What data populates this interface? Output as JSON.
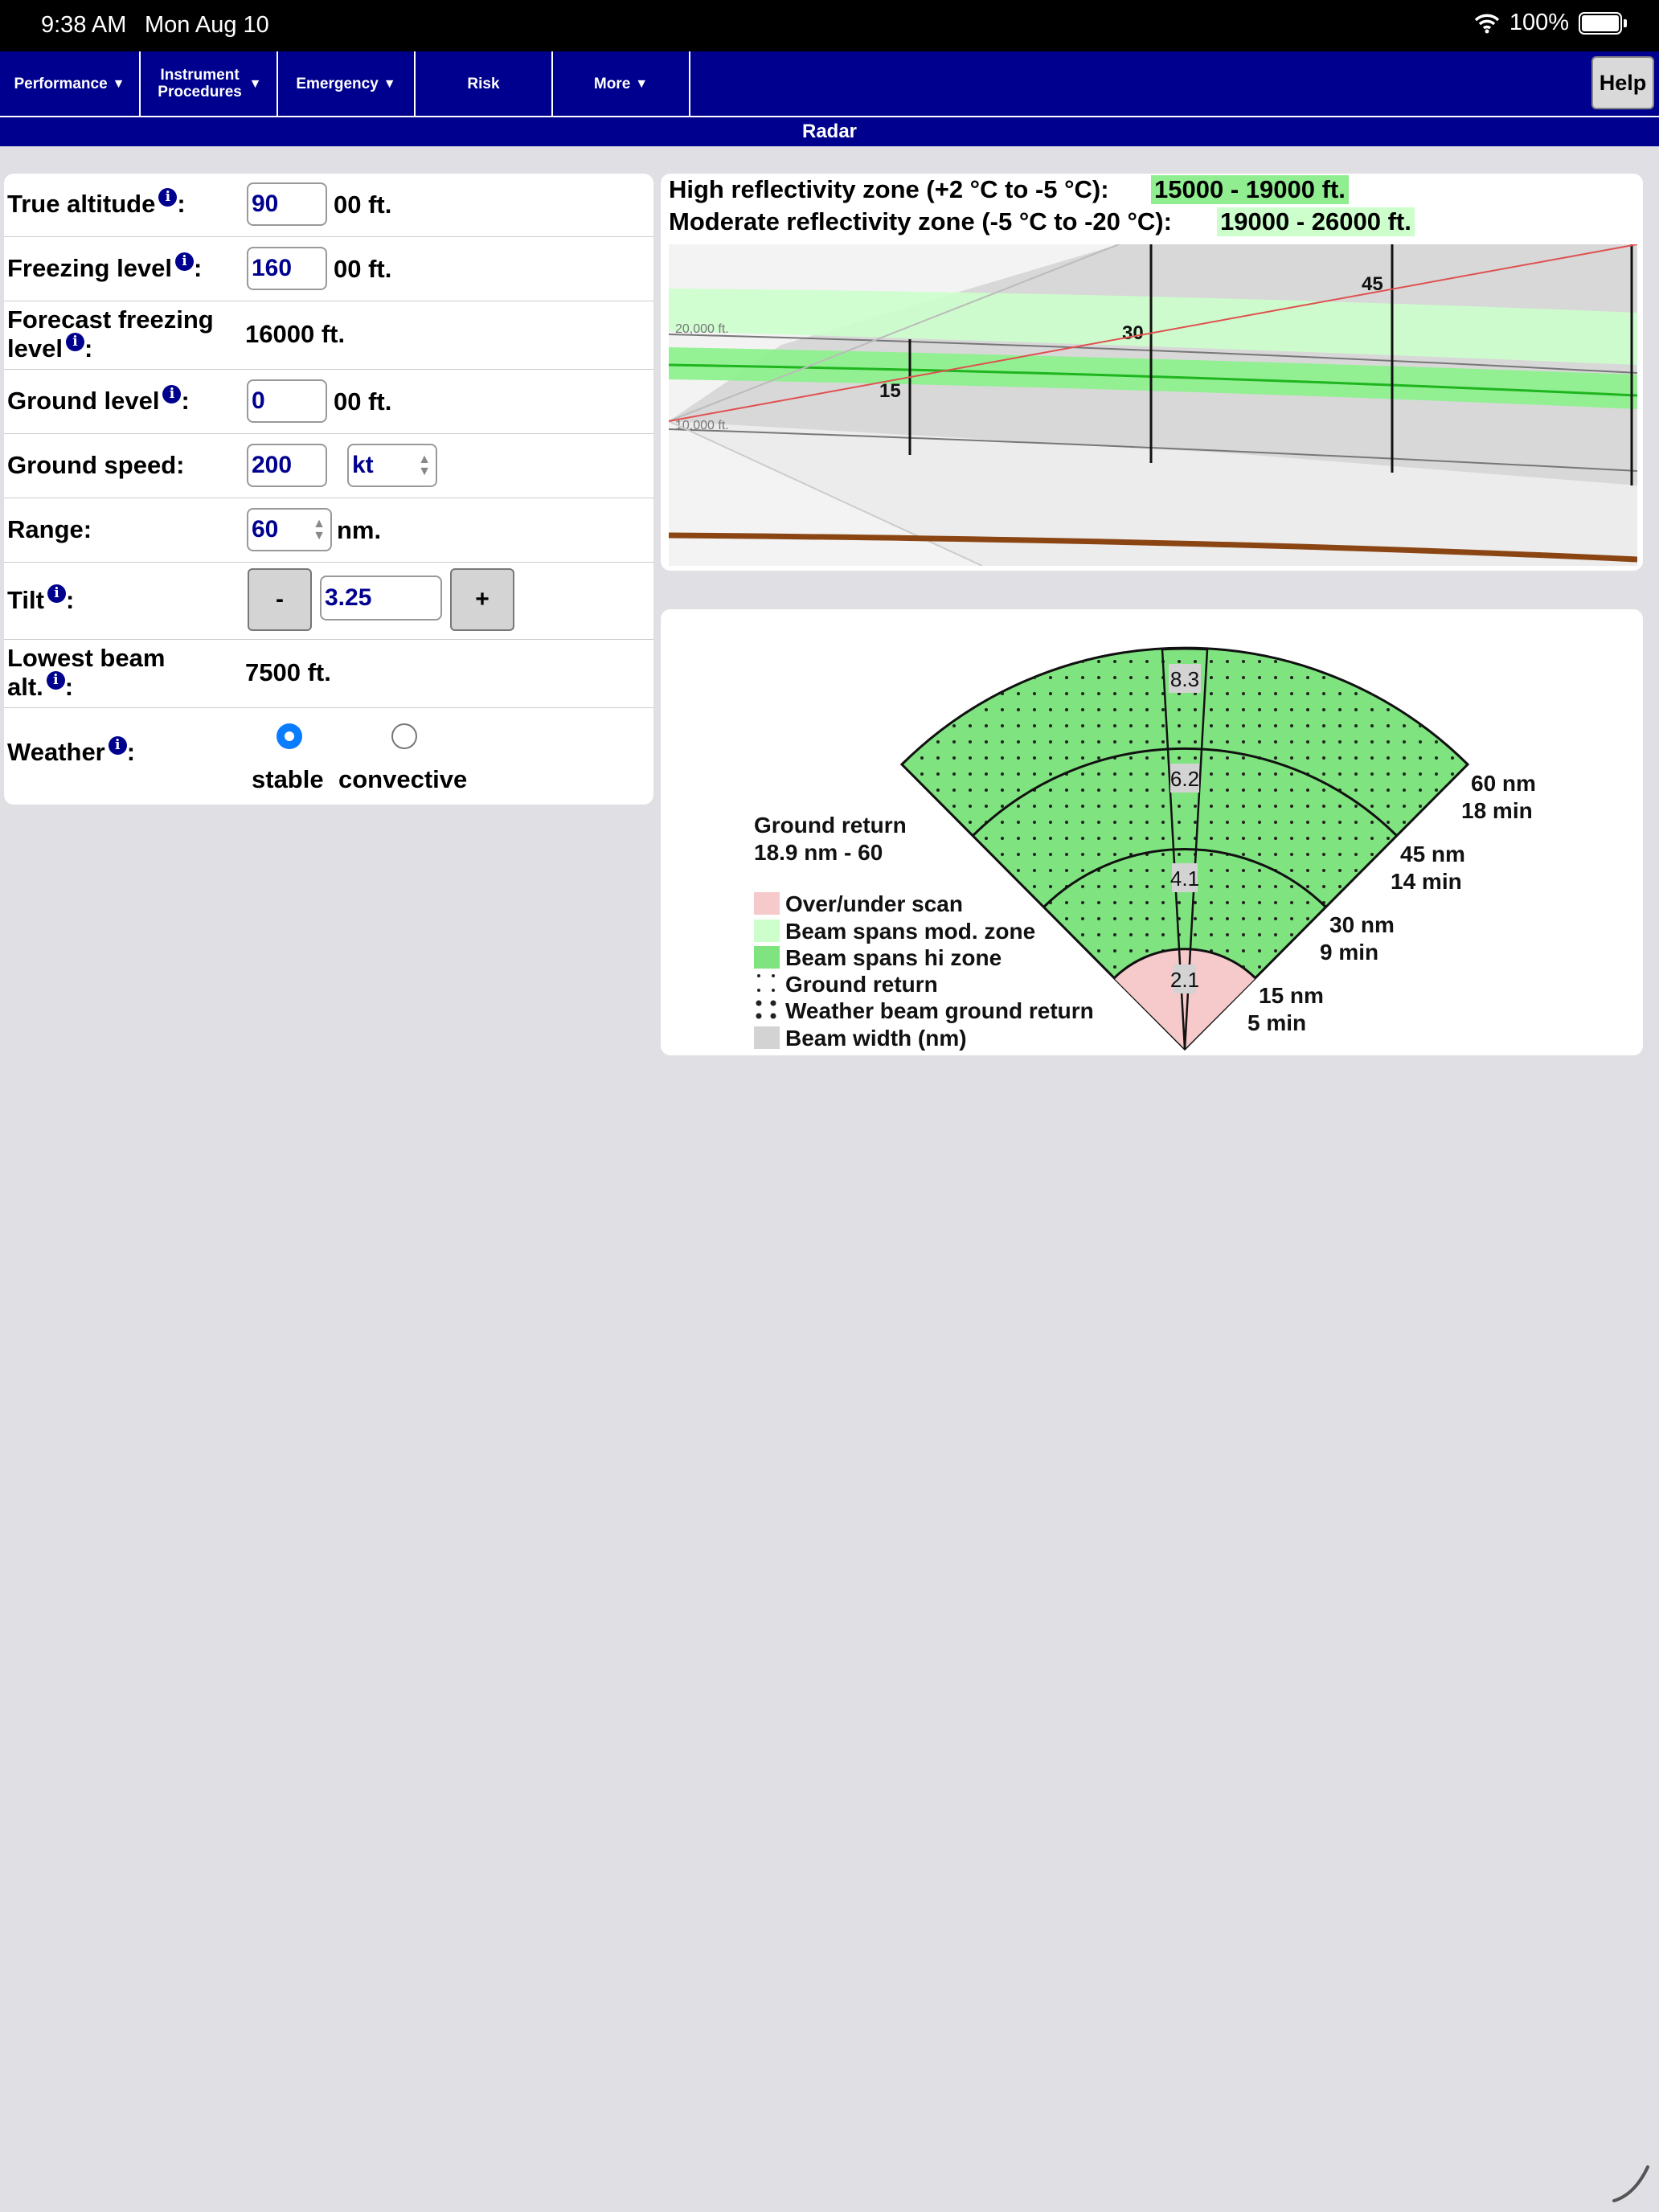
{
  "status": {
    "time": "9:38 AM",
    "date": "Mon Aug 10",
    "battery": "100%",
    "wifi_icon": "wifi-icon",
    "battery_icon": "battery-icon"
  },
  "nav": {
    "items": [
      {
        "label": "Performance",
        "caret": "▼"
      },
      {
        "label": "Instrument Procedures",
        "caret": "▼"
      },
      {
        "label": "Emergency",
        "caret": "▼"
      },
      {
        "label": "Risk",
        "caret": ""
      },
      {
        "label": "More",
        "caret": "▼"
      }
    ],
    "help": "Help"
  },
  "page_title": "Radar",
  "form": {
    "true_altitude": {
      "label": "True altitude",
      "value": "90",
      "unit": "00 ft."
    },
    "freezing_level": {
      "label": "Freezing level",
      "value": "160",
      "unit": "00 ft."
    },
    "forecast_freezing": {
      "label1": "Forecast freezing",
      "label2": "level",
      "value": "16000 ft."
    },
    "ground_level": {
      "label": "Ground level",
      "value": "0",
      "unit": "00 ft."
    },
    "ground_speed": {
      "label": "Ground speed:",
      "value": "200",
      "unit_select": "kt"
    },
    "range": {
      "label": "Range:",
      "value": "60",
      "unit": "nm."
    },
    "tilt": {
      "label": "Tilt",
      "minus": "-",
      "value": "3.25",
      "plus": "+"
    },
    "lowest_beam": {
      "label1": "Lowest beam",
      "label2": "alt.",
      "value": "7500 ft."
    },
    "weather": {
      "label": "Weather",
      "options": [
        "stable",
        "convective"
      ],
      "selected": "stable"
    },
    "info_glyph": "i",
    "colon": ":"
  },
  "zones": {
    "high_label": "High reflectivity zone (+2 °C to -5 °C):",
    "high_value": "15000 - 19000 ft.",
    "mod_label": "Moderate reflectivity zone (-5 °C to -20 °C):",
    "mod_value": "19000 - 26000 ft.",
    "high_color": "#90ee90",
    "mod_color": "#ccffcc"
  },
  "profile": {
    "alt_labels": [
      "20,000 ft.",
      "10,000 ft."
    ],
    "range_markers": [
      "15",
      "30",
      "45"
    ],
    "terrain_color": "#8b4513",
    "beam_centre_color": "#e05050"
  },
  "sector": {
    "beam_widths": [
      "8.3",
      "6.2",
      "4.1",
      "2.1"
    ],
    "range_labels": [
      {
        "nm": "60 nm",
        "min": "18 min"
      },
      {
        "nm": "45 nm",
        "min": "14 min"
      },
      {
        "nm": "30 nm",
        "min": "9 min"
      },
      {
        "nm": "15 nm",
        "min": "5 min"
      }
    ],
    "ground_return_title": "Ground return",
    "ground_return_range": "18.9 nm - 60",
    "legend": [
      {
        "label": "Over/under scan",
        "swatch": "pink"
      },
      {
        "label": "Beam spans mod. zone",
        "swatch": "light-green"
      },
      {
        "label": "Beam spans hi zone",
        "swatch": "green"
      },
      {
        "label": "Ground return",
        "swatch": "sparse-dots"
      },
      {
        "label": "Weather beam ground return",
        "swatch": "dense-dots"
      },
      {
        "label": "Beam width (nm)",
        "swatch": "grey"
      }
    ]
  }
}
